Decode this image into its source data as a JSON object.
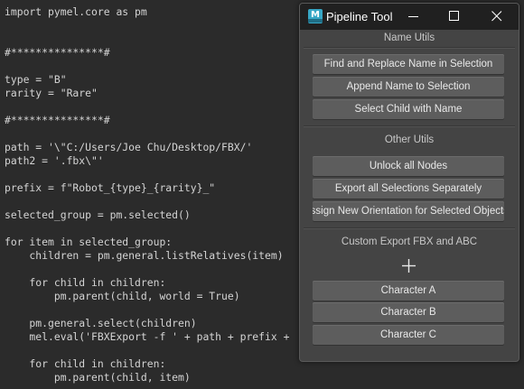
{
  "editor": {
    "lines": [
      "import pymel.core as pm",
      "",
      "",
      "#***************#",
      "",
      "type = \"B\"",
      "rarity = \"Rare\"",
      "",
      "#***************#",
      "",
      "path = '\\\"C:/Users/Joe Chu/Desktop/FBX/'",
      "path2 = '.fbx\\\"'",
      "",
      "prefix = f\"Robot_{type}_{rarity}_\"",
      "",
      "selected_group = pm.selected()",
      "",
      "for item in selected_group:",
      "    children = pm.general.listRelatives(item)",
      "",
      "    for child in children:",
      "        pm.parent(child, world = True)",
      "",
      "    pm.general.select(children)",
      "    mel.eval('FBXExport -f ' + path + prefix +",
      "",
      "    for child in children:",
      "        pm.parent(child, item)"
    ]
  },
  "window": {
    "title": "Pipeline Tool",
    "icon_letter": "M",
    "minimize_icon": "minimize-icon",
    "maximize_icon": "maximize-icon",
    "close_icon": "close-icon"
  },
  "sections": {
    "name_utils": {
      "label": "Name Utils",
      "buttons": [
        "Find and Replace Name in Selection",
        "Append Name to Selection",
        "Select Child with Name"
      ]
    },
    "other_utils": {
      "label": "Other Utils",
      "buttons": [
        "Unlock all Nodes",
        "Export all Selections Separately",
        "Assign New Orientation for Selected Objects"
      ]
    },
    "custom_export": {
      "label": "Custom Export FBX and ABC",
      "add_icon": "plus-icon",
      "buttons": [
        "Character A",
        "Character B",
        "Character C"
      ]
    }
  }
}
